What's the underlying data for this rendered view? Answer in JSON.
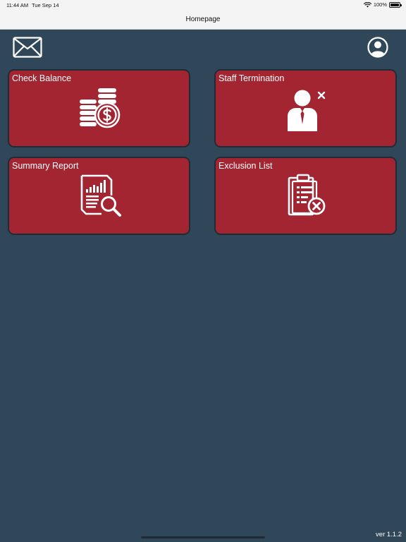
{
  "status_bar": {
    "time": "11:44 AM",
    "date": "Tue Sep 14",
    "battery": "100%"
  },
  "nav": {
    "title": "Homepage"
  },
  "toolbar": {
    "mail_icon": "envelope-icon",
    "profile_icon": "user-circle-icon"
  },
  "tiles": [
    {
      "label": "Check Balance",
      "icon": "coins-dollar-icon"
    },
    {
      "label": "Staff Termination",
      "icon": "staff-remove-icon"
    },
    {
      "label": "Summary Report",
      "icon": "report-search-icon"
    },
    {
      "label": "Exclusion List",
      "icon": "clipboard-exclude-icon"
    }
  ],
  "footer": {
    "version": "ver 1.1.2"
  },
  "colors": {
    "background": "#30475a",
    "tile": "#a42532",
    "tile_border": "#1f2c37",
    "bar": "#f4f4f4"
  }
}
